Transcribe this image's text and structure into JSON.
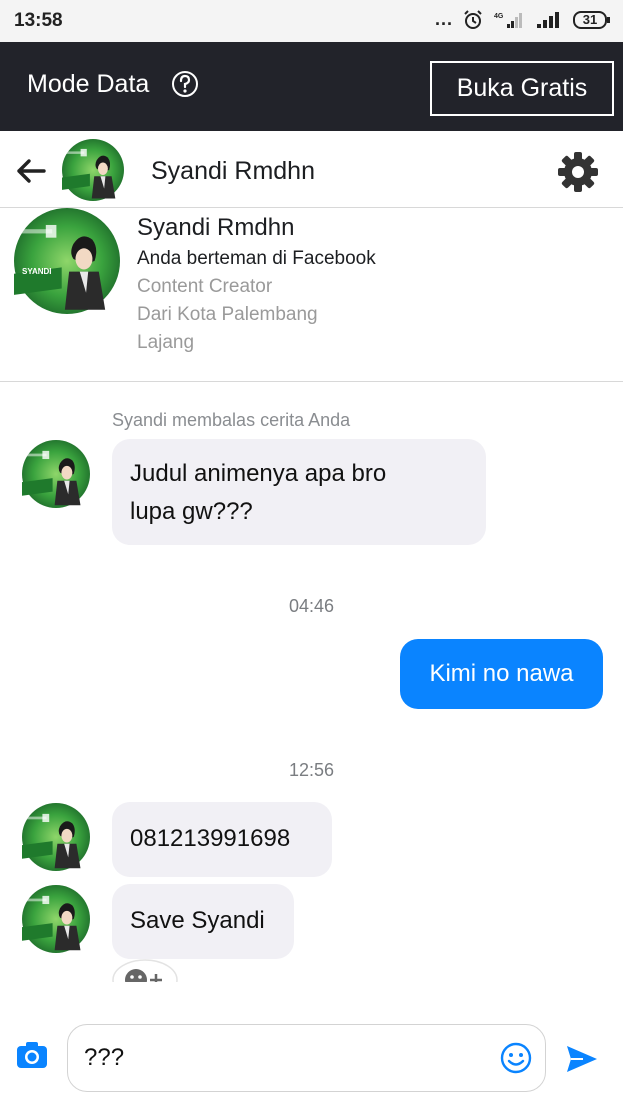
{
  "status_bar": {
    "time": "13:58",
    "dots": "...",
    "network": "4G",
    "battery": "31"
  },
  "data_bar": {
    "label": "Mode Data",
    "button": "Buka Gratis"
  },
  "header": {
    "name": "Syandi Rmdhn"
  },
  "profile": {
    "name": "Syandi Rmdhn",
    "friends": "Anda berteman di Facebook",
    "job": "Content Creator",
    "city": "Dari Kota Palembang",
    "relationship": "Lajang",
    "avatar_text": "SYANDI"
  },
  "messages": {
    "story_reply_note": "Syandi membalas cerita Anda",
    "msg1_line1": "Judul animenya apa bro",
    "msg1_line2": "lupa gw???",
    "time1": "04:46",
    "msg2": "Kimi no nawa",
    "time2": "12:56",
    "msg3": "081213991698",
    "msg4": "Save Syandi"
  },
  "composer": {
    "value": "???"
  },
  "colors": {
    "accent": "#0a84ff",
    "dark_bar": "#22232a",
    "incoming_bubble": "#f1f0f5",
    "avatar_green": "#2e9e3c"
  }
}
